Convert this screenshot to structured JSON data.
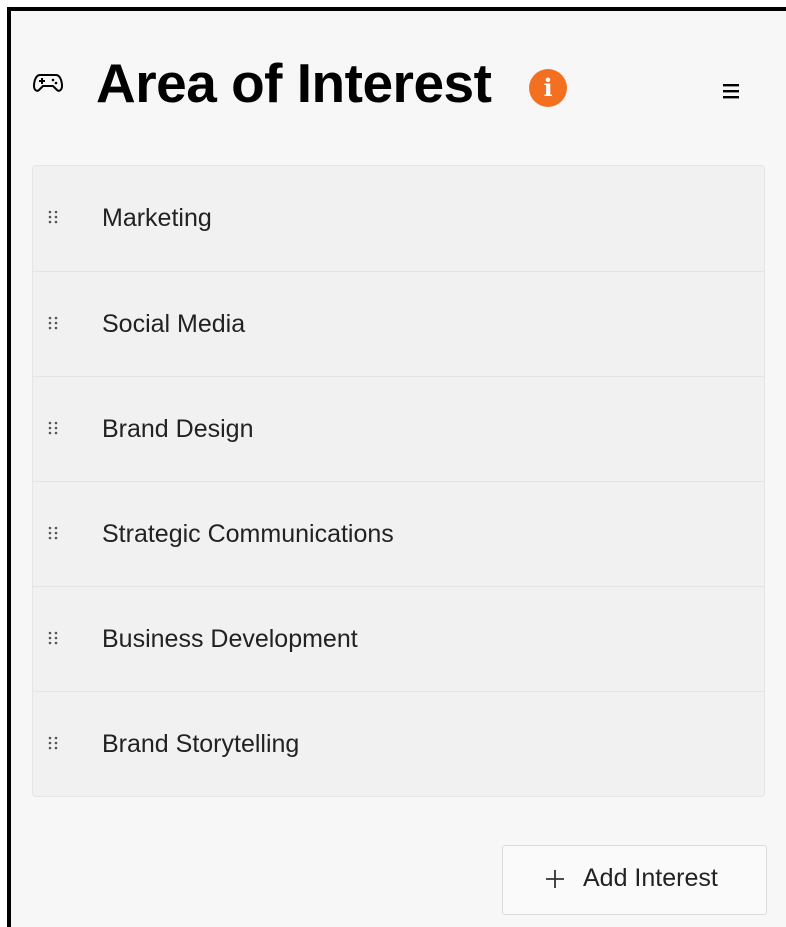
{
  "header": {
    "title": "Area of Interest",
    "icon": "gamepad-icon",
    "info_icon": "info-icon",
    "info_glyph": "i",
    "menu_icon": "hamburger-menu-icon"
  },
  "colors": {
    "accent": "#f37021",
    "background": "#f7f7f7",
    "list_background": "#f1f1f1"
  },
  "interests": [
    {
      "label": "Marketing"
    },
    {
      "label": "Social Media"
    },
    {
      "label": "Brand Design"
    },
    {
      "label": "Strategic Communications"
    },
    {
      "label": "Business Development"
    },
    {
      "label": "Brand Storytelling"
    }
  ],
  "add_button": {
    "label": "Add Interest",
    "icon": "plus-icon"
  }
}
